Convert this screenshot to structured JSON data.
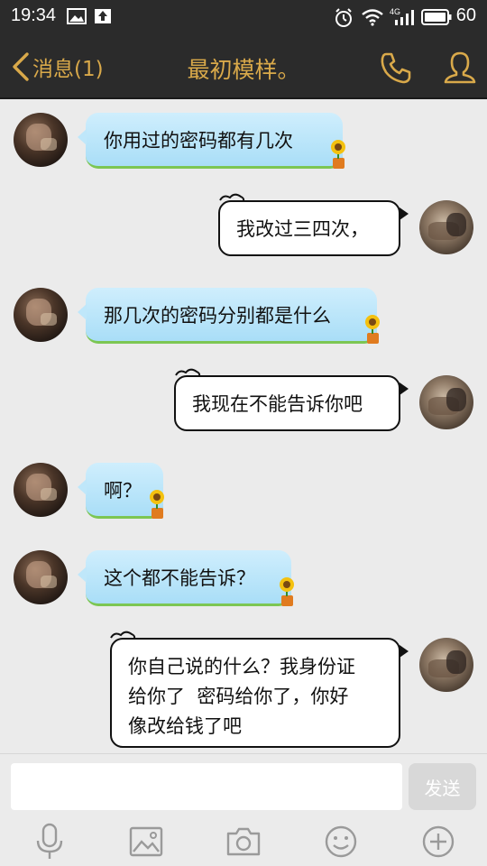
{
  "status_bar": {
    "time": "19:34",
    "network_type": "4G",
    "battery": "60"
  },
  "nav": {
    "back_label": "消息(1)",
    "title": "最初模样。"
  },
  "messages": [
    {
      "side": "in",
      "text": "你用过的密码都有几次"
    },
    {
      "side": "out",
      "text": "我改过三四次，"
    },
    {
      "side": "in",
      "text": "那几次的密码分别都是什么"
    },
    {
      "side": "out",
      "text": "我现在不能告诉你吧"
    },
    {
      "side": "in",
      "text": "啊？"
    },
    {
      "side": "in",
      "text": "这个都不能告诉？"
    },
    {
      "side": "out",
      "lines": [
        "你自己说的什么？我身份证",
        "给你了  密码给你了，你好",
        "像改给钱了吧"
      ]
    }
  ],
  "composer": {
    "input_value": "",
    "send_label": "发送"
  },
  "toolbar": [
    "microphone",
    "image",
    "camera",
    "emoji",
    "plus"
  ],
  "colors": {
    "bar_bg": "#2b2b2b",
    "accent": "#d9a94a",
    "incoming_bubble": "#a9def7",
    "outgoing_bubble": "#ffffff",
    "chat_bg": "#ebebeb"
  }
}
